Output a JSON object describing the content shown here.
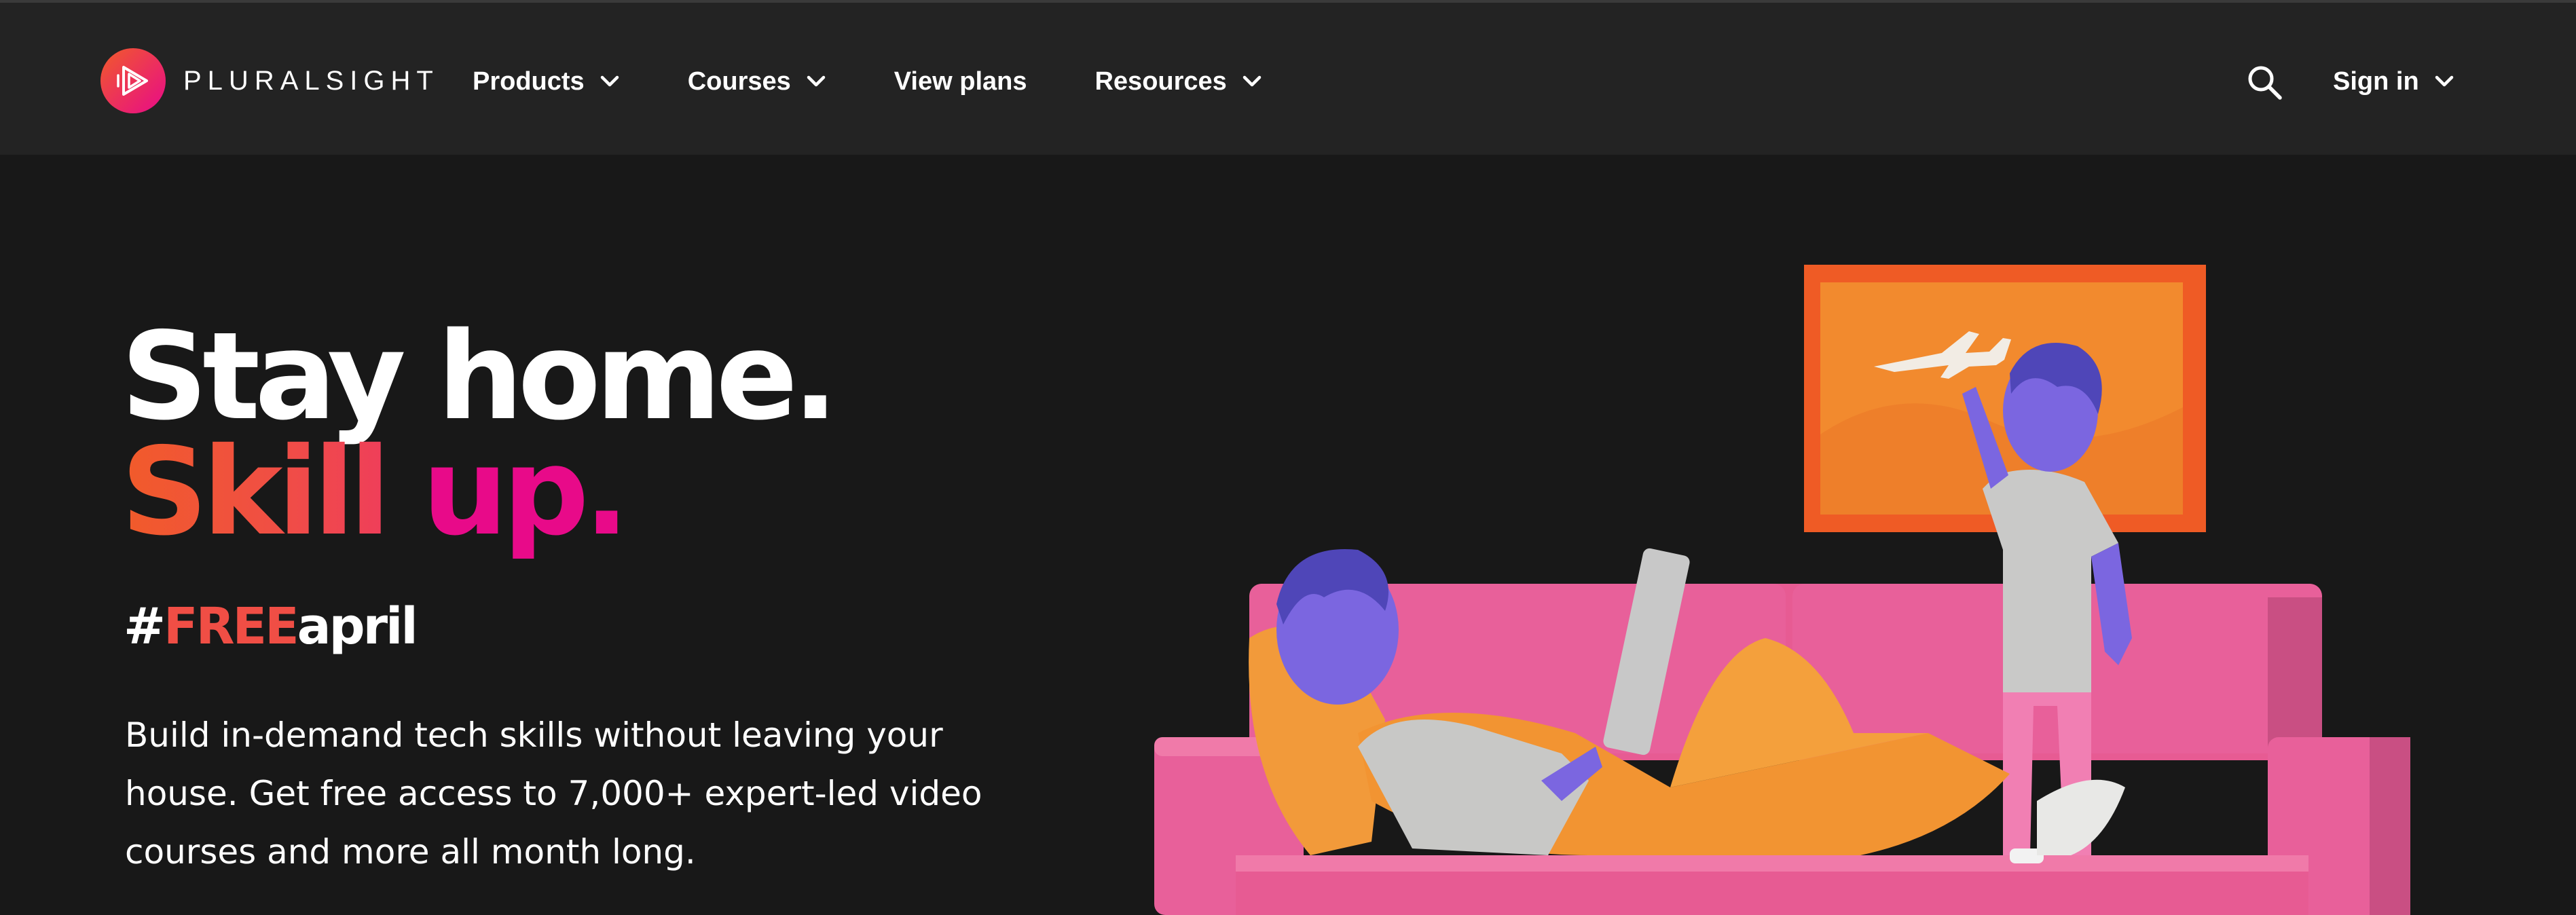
{
  "brand": {
    "name": "PLURALSIGHT",
    "logo_icon": "play-triangle-icon",
    "colors": {
      "orange": "#f15b2a",
      "pink": "#e80a89",
      "nav_bg": "#232323",
      "page_bg": "#181818"
    }
  },
  "nav": {
    "items": [
      {
        "label": "Products",
        "has_dropdown": true
      },
      {
        "label": "Courses",
        "has_dropdown": true
      },
      {
        "label": "View plans",
        "has_dropdown": false
      },
      {
        "label": "Resources",
        "has_dropdown": true
      }
    ],
    "search_icon": "search-icon",
    "signin_label": "Sign in"
  },
  "hero": {
    "line1": "Stay home.",
    "line2_part1": "Skill",
    "line2_part2": "up.",
    "hashtag_hash": "#",
    "hashtag_free": "FREE",
    "hashtag_rest": "april",
    "description": "Build in-demand tech skills without leaving your house. Get free access to 7,000+ expert-led video courses and more all month long."
  }
}
